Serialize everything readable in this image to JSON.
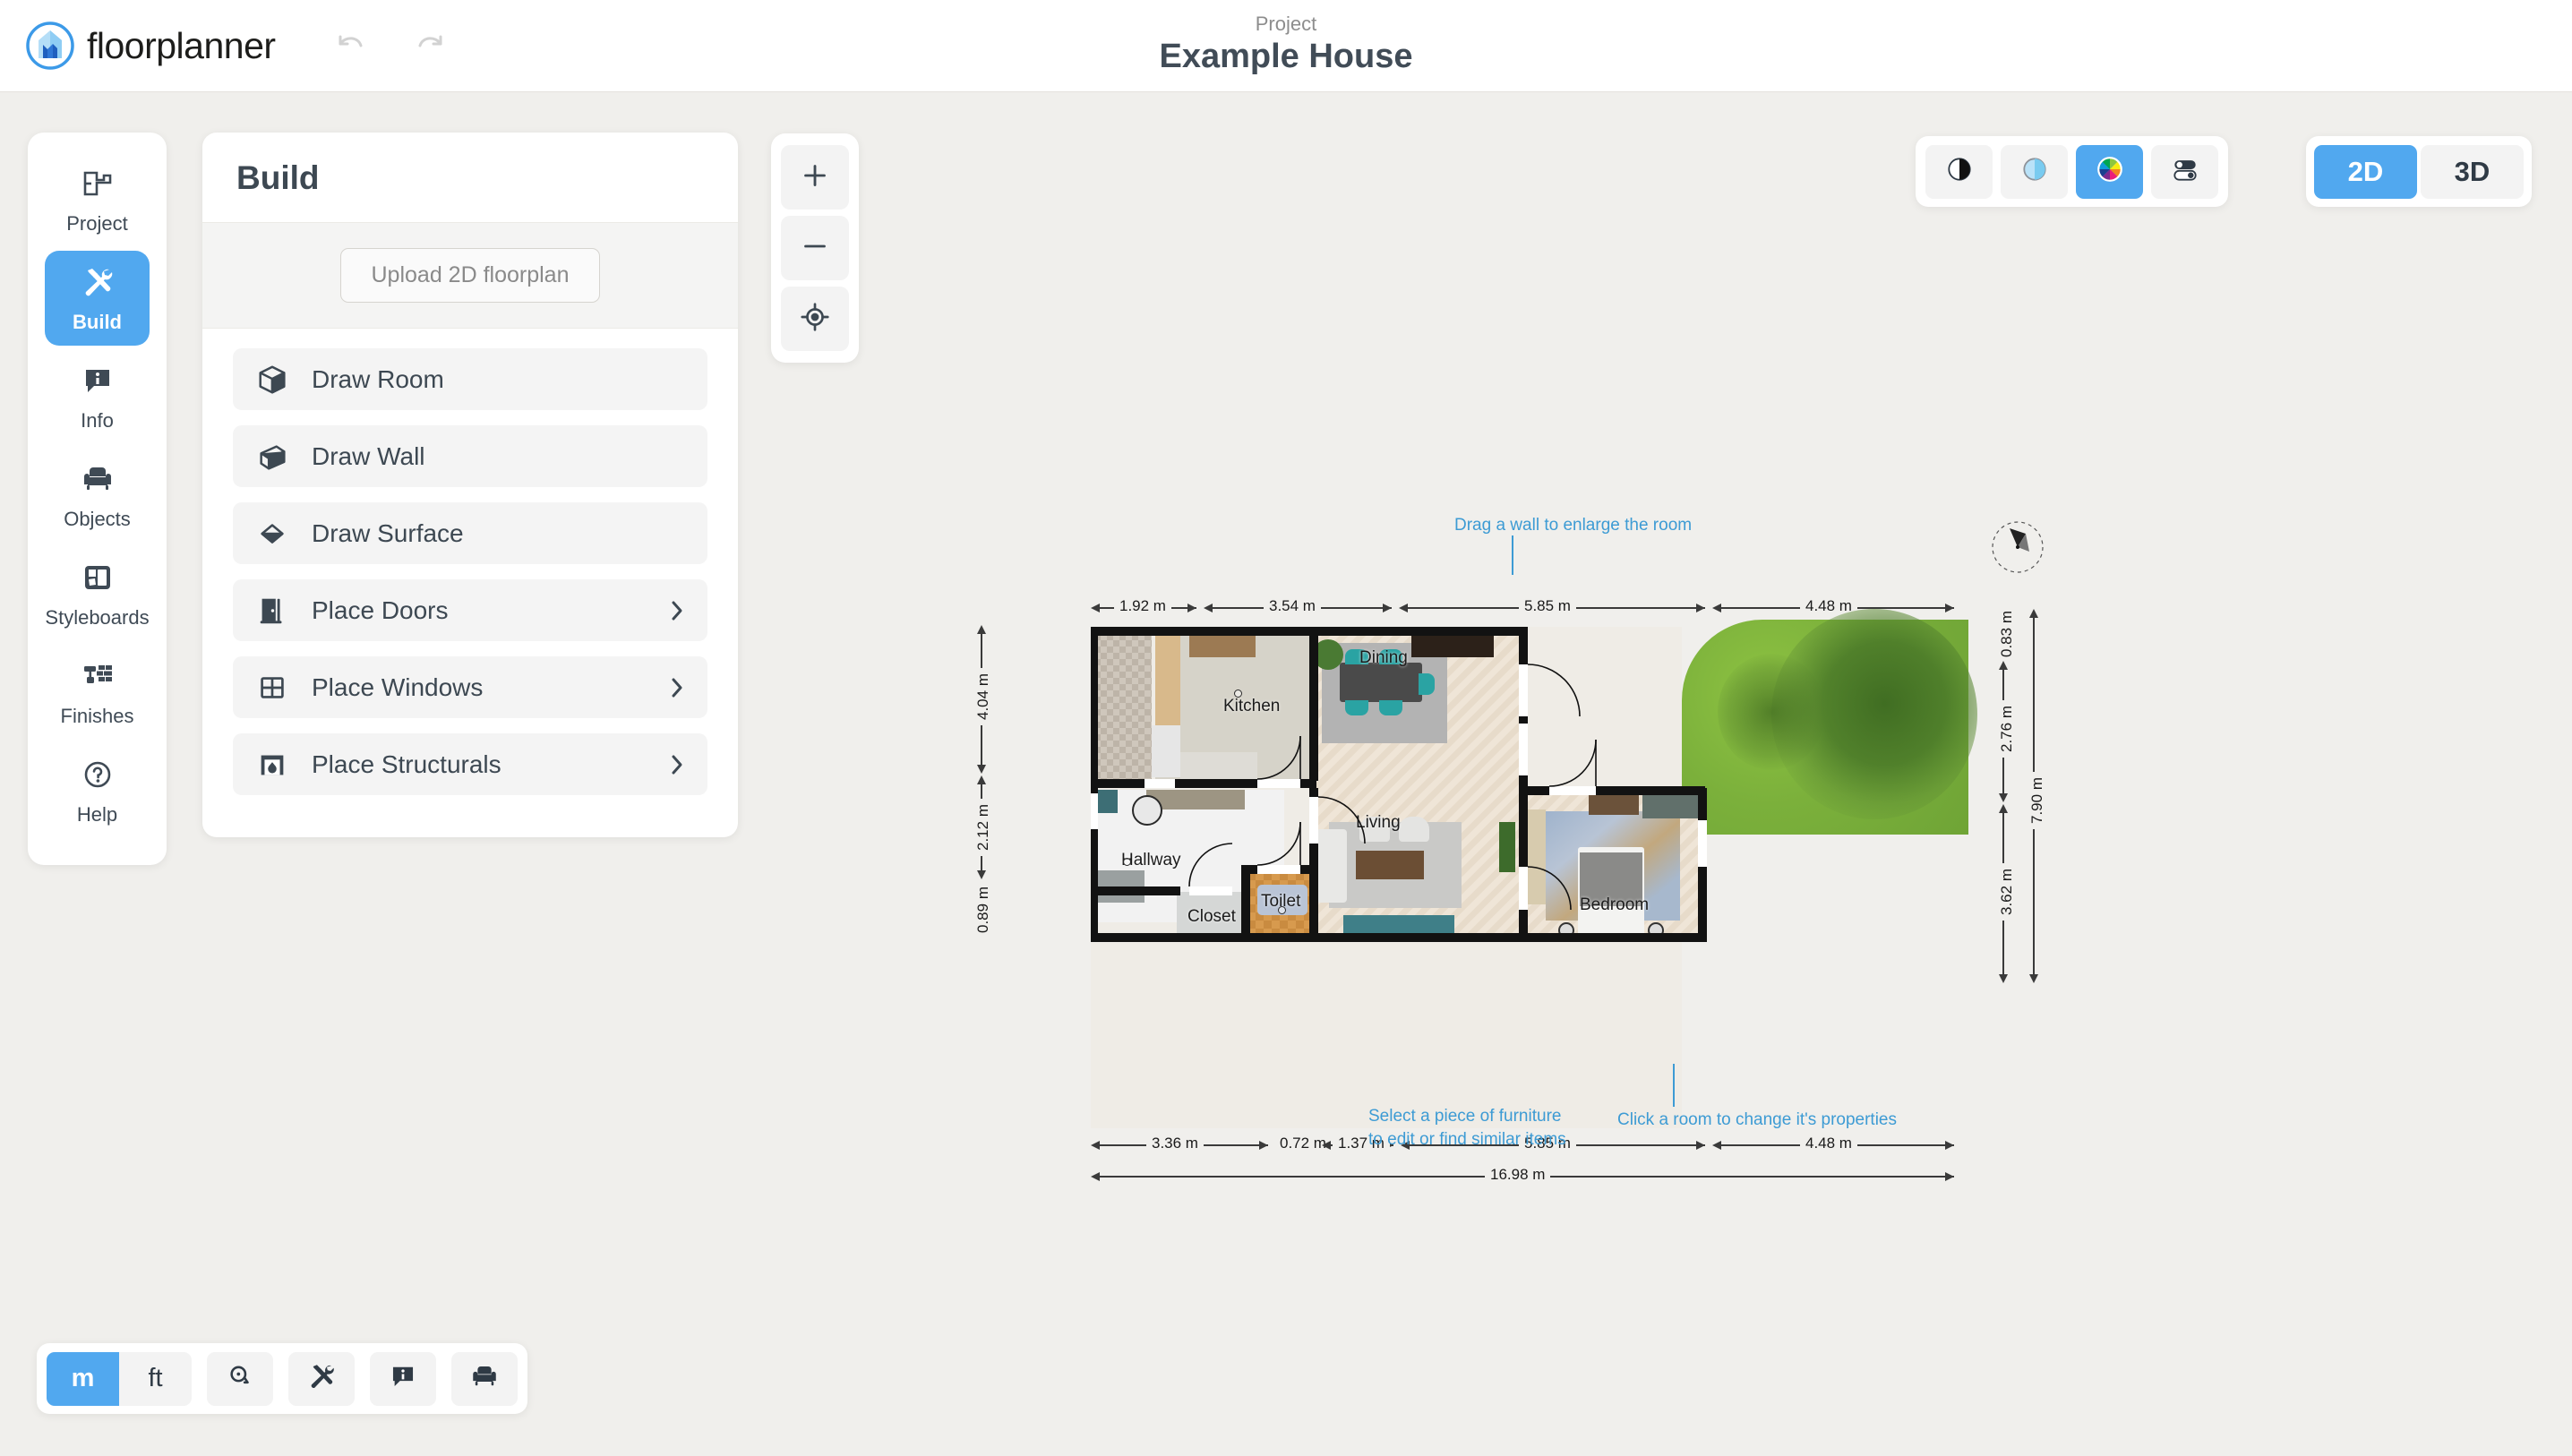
{
  "header": {
    "brand": "floorplanner",
    "logo_icon": "floorplanner-logo-icon",
    "undo_icon": "undo-icon",
    "redo_icon": "redo-icon",
    "project_label": "Project",
    "project_title": "Example House"
  },
  "sidebar": {
    "items": [
      {
        "label": "Project",
        "icon": "floorplan-outline-icon",
        "active": false
      },
      {
        "label": "Build",
        "icon": "hammer-wrench-icon",
        "active": true
      },
      {
        "label": "Info",
        "icon": "info-bubble-icon",
        "active": false
      },
      {
        "label": "Objects",
        "icon": "armchair-icon",
        "active": false
      },
      {
        "label": "Styleboards",
        "icon": "styleboard-icon",
        "active": false
      },
      {
        "label": "Finishes",
        "icon": "paint-roller-brick-icon",
        "active": false
      },
      {
        "label": "Help",
        "icon": "question-circle-icon",
        "active": false
      }
    ]
  },
  "panel": {
    "title": "Build",
    "upload_label": "Upload 2D floorplan",
    "items": [
      {
        "label": "Draw Room",
        "icon": "cube-icon",
        "chevron": false
      },
      {
        "label": "Draw Wall",
        "icon": "wall-slab-icon",
        "chevron": false
      },
      {
        "label": "Draw Surface",
        "icon": "diamond-icon",
        "chevron": false
      },
      {
        "label": "Place Doors",
        "icon": "door-icon",
        "chevron": true
      },
      {
        "label": "Place Windows",
        "icon": "window-grid-icon",
        "chevron": true
      },
      {
        "label": "Place Structurals",
        "icon": "fireplace-icon",
        "chevron": true
      }
    ]
  },
  "zoom_controls": [
    {
      "name": "zoom-in-button",
      "icon": "plus-icon"
    },
    {
      "name": "zoom-out-button",
      "icon": "minus-icon"
    },
    {
      "name": "recenter-button",
      "icon": "crosshair-target-icon"
    }
  ],
  "render_tools": [
    {
      "name": "blackwhite-style-button",
      "icon": "contrast-circle-icon",
      "active": false
    },
    {
      "name": "monochrome-style-button",
      "icon": "blue-circle-icon",
      "active": false
    },
    {
      "name": "color-style-button",
      "icon": "color-wheel-icon",
      "active": true
    },
    {
      "name": "display-settings-button",
      "icon": "toggles-icon",
      "active": false
    }
  ],
  "view_toggle": {
    "options": [
      {
        "label": "2D",
        "active": true
      },
      {
        "label": "3D",
        "active": false
      }
    ]
  },
  "bottom_toolbar": {
    "units": [
      {
        "label": "m",
        "active": true
      },
      {
        "label": "ft",
        "active": false
      }
    ],
    "buttons": [
      {
        "name": "measure-tape-button",
        "icon": "measuring-tape-icon"
      },
      {
        "name": "build-tools-button",
        "icon": "hammer-wrench-icon"
      },
      {
        "name": "info-button",
        "icon": "info-bubble-icon"
      },
      {
        "name": "furniture-button",
        "icon": "armchair-icon"
      }
    ]
  },
  "floorplan": {
    "accent_color": "#51a8ef",
    "hint_color": "#3d9bd4",
    "hints": [
      {
        "name": "hint-drag-wall",
        "text": "Drag a wall to enlarge the room"
      },
      {
        "name": "hint-select-furniture",
        "text": "Select a piece of furniture\nto edit or find similar items"
      },
      {
        "name": "hint-click-room",
        "text": "Click a room to change it's properties"
      }
    ],
    "rooms": [
      {
        "name": "Kitchen"
      },
      {
        "name": "Hallway"
      },
      {
        "name": "Toilet"
      },
      {
        "name": "Closet"
      },
      {
        "name": "Dining"
      },
      {
        "name": "Living"
      },
      {
        "name": "Bedroom"
      }
    ],
    "dimensions": {
      "top": [
        "1.92 m",
        "3.54 m",
        "5.85 m",
        "4.48 m"
      ],
      "bottom": [
        "3.36 m",
        "0.72 m",
        "1.37 m",
        "5.85 m",
        "4.48 m"
      ],
      "total_width": "16.98 m",
      "left": [
        "4.04 m",
        "2.12 m",
        "0.89 m"
      ],
      "right": [
        "0.83 m",
        "2.76 m",
        "3.62 m"
      ],
      "total_height": "7.90 m"
    },
    "compass": "north-compass-icon"
  }
}
